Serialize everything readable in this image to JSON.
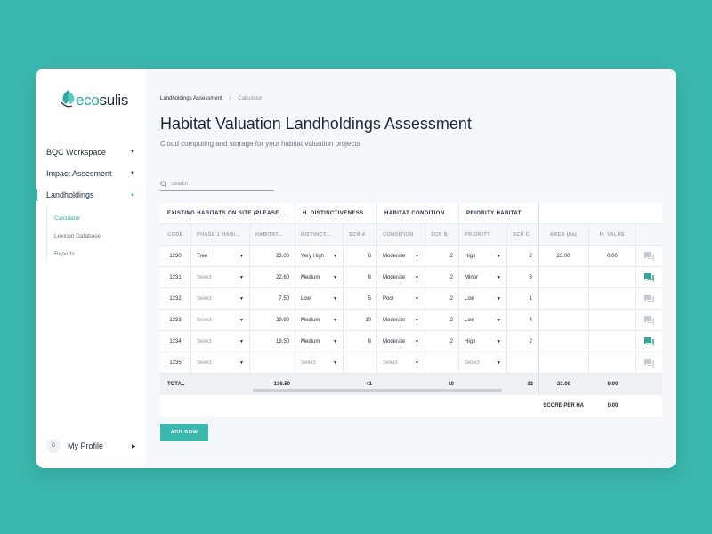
{
  "logo": {
    "text_prefix": "eco",
    "text_suffix": "sulis"
  },
  "nav": [
    {
      "label": "BQC Workspace",
      "caret": "▼"
    },
    {
      "label": "Impact Assesment",
      "caret": "▼"
    },
    {
      "label": "Landholdings",
      "caret": "▲"
    }
  ],
  "subnav": [
    {
      "label": "Calculator"
    },
    {
      "label": "Lexicon Database"
    },
    {
      "label": "Reports"
    }
  ],
  "profile": {
    "initial": "D",
    "label": "My Profile",
    "caret": "▶"
  },
  "breadcrumb": {
    "parent": "Landholdings Assessment",
    "separator": "/",
    "current": "Calculator"
  },
  "page": {
    "title": "Habitat Valuation Landholdings Assessment",
    "subtitle": "Cloud computing and storage for your habitat valuation projects"
  },
  "search": {
    "placeholder": "Search"
  },
  "table": {
    "groups": [
      "EXISTING HABITATS ON SITE (PLEASE ...",
      "H. DISTINCTIVENESS",
      "HABITAT CONDITION",
      "PRIORITY HABITAT"
    ],
    "columns": [
      "CODE",
      "PHASE 1 HABI...",
      "HABITAT...",
      "DISTINCT...",
      "SCR A",
      "CONDITION",
      "SCR B",
      "PRIORITY",
      "SCR C",
      "AREA (ha)",
      "H. VALUE"
    ],
    "rows": [
      {
        "code": "1230",
        "phase": "Tree",
        "habitat": "23.00",
        "distinct": "Very High",
        "scr_a": "6",
        "condition": "Moderate",
        "scr_b": "2",
        "priority": "High",
        "scr_c": "2",
        "area": "23.00",
        "hvalue": "0.00",
        "comment_active": false
      },
      {
        "code": "1231",
        "phase": "Select",
        "habitat": "22.60",
        "distinct": "Medium",
        "scr_a": "8",
        "condition": "Moderate",
        "scr_b": "2",
        "priority": "Minor",
        "scr_c": "3",
        "area": "",
        "hvalue": "",
        "comment_active": true
      },
      {
        "code": "1232",
        "phase": "Select",
        "habitat": "7.50",
        "distinct": "Low",
        "scr_a": "5",
        "condition": "Poor",
        "scr_b": "2",
        "priority": "Low",
        "scr_c": "1",
        "area": "",
        "hvalue": "",
        "comment_active": false
      },
      {
        "code": "1233",
        "phase": "Select",
        "habitat": "29.90",
        "distinct": "Medium",
        "scr_a": "10",
        "condition": "Moderate",
        "scr_b": "2",
        "priority": "Low",
        "scr_c": "4",
        "area": "",
        "hvalue": "",
        "comment_active": false
      },
      {
        "code": "1234",
        "phase": "Select",
        "habitat": "19.50",
        "distinct": "Medium",
        "scr_a": "8",
        "condition": "Moderate",
        "scr_b": "2",
        "priority": "High",
        "scr_c": "2",
        "area": "",
        "hvalue": "",
        "comment_active": true
      },
      {
        "code": "1235",
        "phase": "Select",
        "habitat": "",
        "distinct": "Select",
        "scr_a": "",
        "condition": "Select",
        "scr_b": "",
        "priority": "Select",
        "scr_c": "",
        "area": "",
        "hvalue": "",
        "comment_active": false
      }
    ],
    "total": {
      "label": "TOTAL",
      "habitat": "136.50",
      "scr_a": "41",
      "scr_b": "10",
      "scr_c": "12",
      "area": "23.00",
      "hvalue": "0.00"
    },
    "score": {
      "label": "SCORE PER HA",
      "value": "0.00"
    }
  },
  "add_row_label": "ADD ROW",
  "colors": {
    "accent": "#3bb8ae",
    "comment_active": "#2fa89d",
    "comment_inactive": "#c3cbd2"
  }
}
